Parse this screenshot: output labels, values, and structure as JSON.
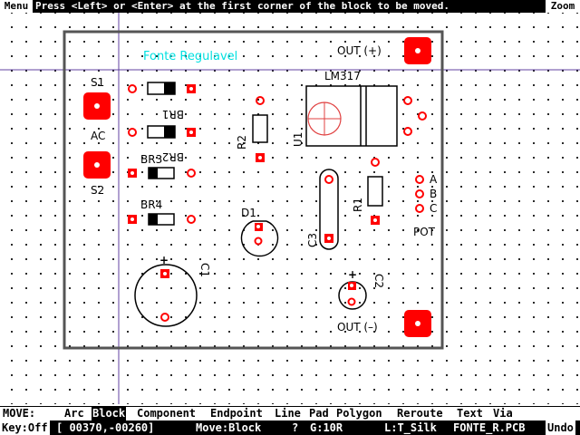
{
  "topbar": {
    "menu_label": "Menu",
    "prompt": "Press <Left> or <Enter> at the first corner of the block to be moved.",
    "zoom_label": "Zoom"
  },
  "board": {
    "title_text": "Fonte Regulavel",
    "title_color": "#00e0e0",
    "pad_color": "#ff0000",
    "labels": {
      "out_plus": "OUT (+)",
      "out_minus": "OUT (–)",
      "s1": "S1",
      "s2": "S2",
      "ac": "AC",
      "br1": "BR1",
      "br2": "BR2",
      "br3": "BR3",
      "br4": "BR4",
      "lm317": "LM317",
      "u1": "U1",
      "r1": "R1",
      "r2": "R2",
      "d1": "D1",
      "c1": "C1",
      "c2": "C2",
      "c3": "C3",
      "pot": "POT",
      "a": "A",
      "b": "B",
      "c": "C",
      "plus": "+"
    }
  },
  "commands": {
    "mode_label": "MOVE:",
    "items": [
      "Arc",
      "Block",
      "Component",
      "Endpoint",
      "Line",
      "Pad",
      "Polygon",
      "Reroute",
      "Text",
      "Via"
    ],
    "active": "Block"
  },
  "status": {
    "key": "Key:Off",
    "coords": "[ 00370,-00260]",
    "move": "Move:Block",
    "help": "?",
    "grid": "G:10R",
    "layer": "L:T_Silk",
    "file": "FONTE_R.PCB",
    "undo": "Undo"
  }
}
